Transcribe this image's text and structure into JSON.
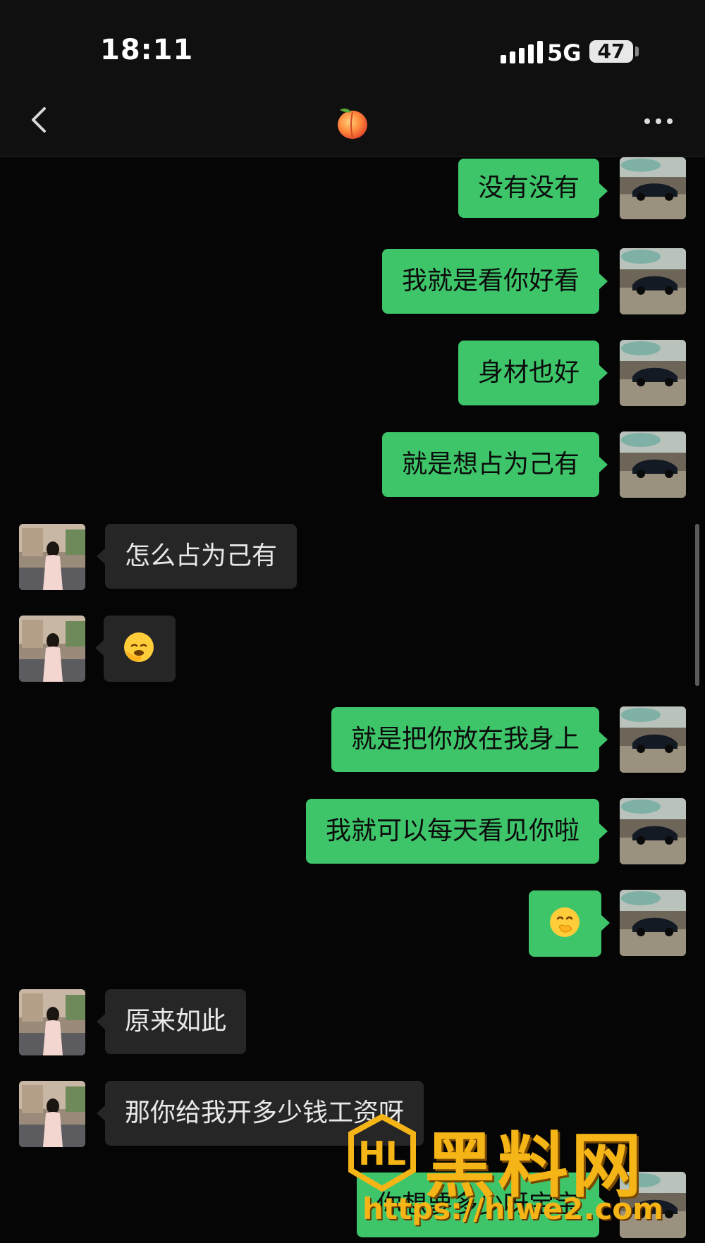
{
  "status_bar": {
    "time": "18:11",
    "network": "5G",
    "battery": "47"
  },
  "nav": {
    "title_icon": "peach-emoji",
    "back_icon": "chevron-left-icon",
    "more_icon": "ellipsis-icon"
  },
  "messages": [
    {
      "side": "out",
      "text": "没有没有"
    },
    {
      "side": "out",
      "text": "我就是看你好看"
    },
    {
      "side": "out",
      "text": "身材也好"
    },
    {
      "side": "out",
      "text": "就是想占为己有"
    },
    {
      "side": "in",
      "text": "怎么占为己有"
    },
    {
      "side": "in",
      "emoji": "facepalm-emoji"
    },
    {
      "side": "out",
      "text": "就是把你放在我身上"
    },
    {
      "side": "out",
      "text": "我就可以每天看见你啦"
    },
    {
      "side": "out",
      "emoji": "giggle-emoji"
    },
    {
      "side": "in",
      "text": "原来如此"
    },
    {
      "side": "in",
      "text": "那你给我开多少钱工资呀"
    },
    {
      "side": "out",
      "text": "你想要多少呀宝宝"
    }
  ],
  "watermark": {
    "title": "黑料网",
    "url": "https://hlwe2.com"
  }
}
